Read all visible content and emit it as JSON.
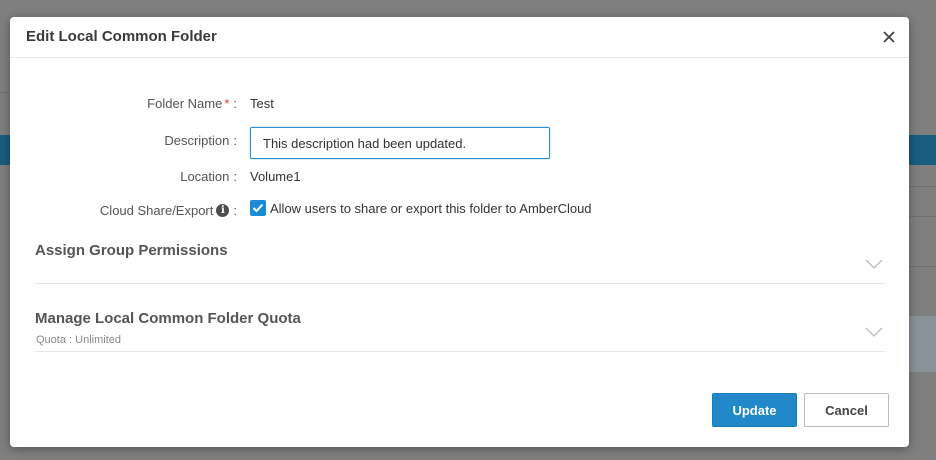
{
  "dialog": {
    "title": "Edit Local Common Folder",
    "close_icon": "close-icon"
  },
  "form": {
    "folder_name": {
      "label": "Folder Name",
      "required_mark": "*",
      "colon": ":",
      "value": "Test"
    },
    "description": {
      "label": "Description",
      "colon": ":",
      "value": "This description had been updated."
    },
    "location": {
      "label": "Location",
      "colon": ":",
      "value": "Volume1"
    },
    "cloud_share": {
      "label": "Cloud Share/Export",
      "colon": ":",
      "info_icon": "info-icon",
      "checked": true,
      "checkbox_label": "Allow users to share or export this folder to AmberCloud"
    }
  },
  "sections": {
    "group_permissions": {
      "title": "Assign Group Permissions"
    },
    "quota": {
      "title": "Manage Local Common Folder Quota",
      "subtitle": "Quota : Unlimited"
    }
  },
  "buttons": {
    "update": "Update",
    "cancel": "Cancel"
  },
  "colors": {
    "primary": "#2189ca",
    "required": "#e03a3a",
    "checkbox": "#1a8ad4"
  }
}
